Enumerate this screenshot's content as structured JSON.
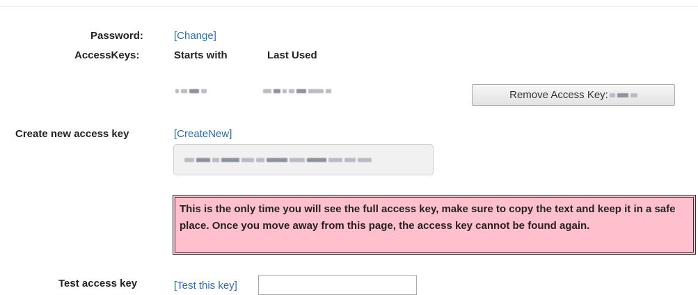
{
  "password": {
    "label": "Password:",
    "change_link": "[Change]"
  },
  "access_keys": {
    "label": "AccessKeys:",
    "col_starts_with": "Starts with",
    "col_last_used": "Last Used",
    "remove_button_label": "Remove Access Key:"
  },
  "create_key": {
    "label": "Create new access key",
    "create_link": "[CreateNew]"
  },
  "warning": {
    "text": "This is the only time you will see the full access key, make sure to copy the text and keep it in a safe place. Once you move away from this page, the access key cannot be found again.",
    "background_color": "#ffc0cb"
  },
  "test_key": {
    "label": "Test access key",
    "test_link": "[Test this key]",
    "input_value": ""
  },
  "colors": {
    "link": "#2a6eb8"
  }
}
